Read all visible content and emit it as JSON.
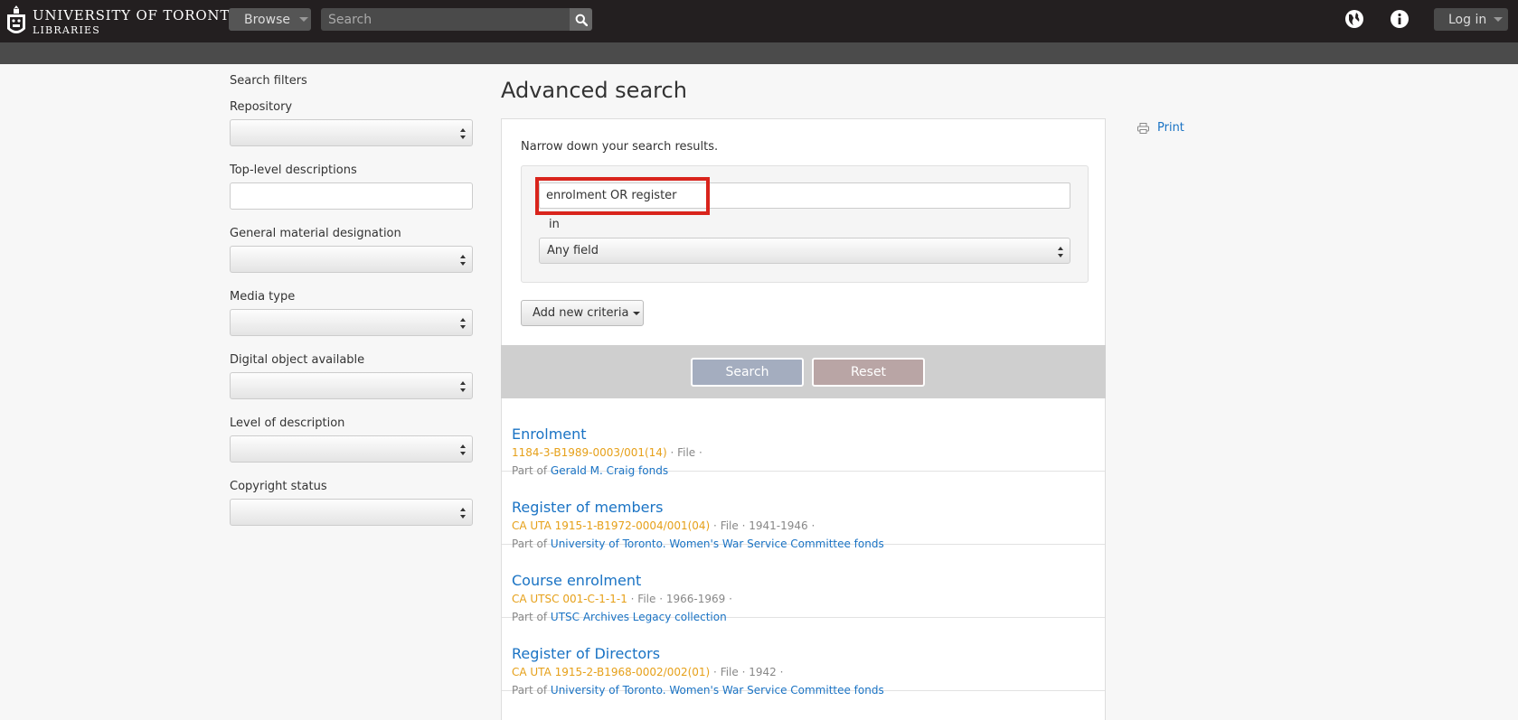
{
  "header": {
    "logo_line1": "UNIVERSITY OF TORONTO",
    "logo_line2": "LIBRARIES",
    "browse_label": "Browse",
    "search_placeholder": "Search",
    "login_label": "Log in"
  },
  "sidebar": {
    "title": "Search filters",
    "filters": [
      {
        "label": "Repository",
        "kind": "select"
      },
      {
        "label": "Top-level descriptions",
        "kind": "text"
      },
      {
        "label": "General material designation",
        "kind": "select"
      },
      {
        "label": "Media type",
        "kind": "select"
      },
      {
        "label": "Digital object available",
        "kind": "select"
      },
      {
        "label": "Level of description",
        "kind": "select"
      },
      {
        "label": "Copyright status",
        "kind": "select"
      }
    ]
  },
  "main": {
    "title": "Advanced search",
    "narrow_text": "Narrow down your search results.",
    "query_value": "enrolment OR register",
    "in_label": "in",
    "field_selected": "Any field",
    "add_criteria_label": "Add new criteria",
    "search_button": "Search",
    "reset_button": "Reset",
    "print_label": "Print"
  },
  "results": [
    {
      "title": "Enrolment",
      "ref": "1184-3-B1989-0003/001(14)",
      "level": "File",
      "dates": "",
      "part_of_label": "Part of",
      "part_of": "Gerald M. Craig fonds"
    },
    {
      "title": "Register of members",
      "ref": "CA UTA 1915-1-B1972-0004/001(04)",
      "level": "File",
      "dates": "1941-1946",
      "part_of_label": "Part of",
      "part_of": "University of Toronto. Women's War Service Committee fonds"
    },
    {
      "title": "Course enrolment",
      "ref": "CA UTSC 001-C-1-1-1",
      "level": "File",
      "dates": "1966-1969",
      "part_of_label": "Part of",
      "part_of": "UTSC Archives Legacy collection"
    },
    {
      "title": "Register of Directors",
      "ref": "CA UTA 1915-2-B1968-0002/002(01)",
      "level": "File",
      "dates": "1942",
      "part_of_label": "Part of",
      "part_of": "University of Toronto. Women's War Service Committee fonds"
    }
  ]
}
